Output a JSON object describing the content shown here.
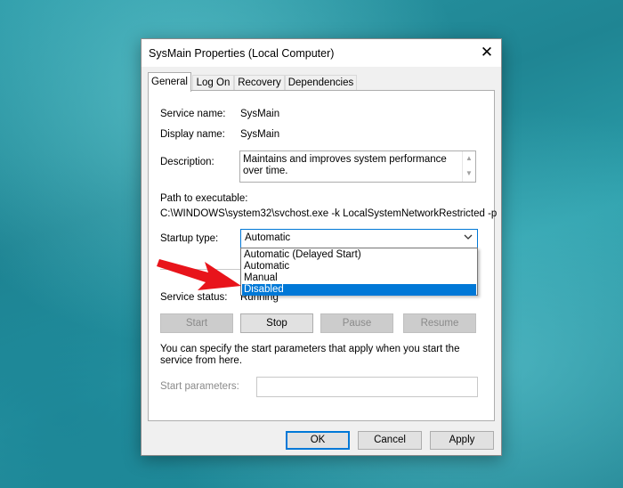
{
  "window": {
    "title": "SysMain Properties (Local Computer)",
    "close_symbol": "✕"
  },
  "tabs": [
    {
      "label": "General",
      "active": true
    },
    {
      "label": "Log On",
      "active": false
    },
    {
      "label": "Recovery",
      "active": false
    },
    {
      "label": "Dependencies",
      "active": false
    }
  ],
  "general": {
    "service_name_label": "Service name:",
    "service_name": "SysMain",
    "display_name_label": "Display name:",
    "display_name": "SysMain",
    "description_label": "Description:",
    "description": "Maintains and improves system performance over time.",
    "path_label": "Path to executable:",
    "path": "C:\\WINDOWS\\system32\\svchost.exe -k LocalSystemNetworkRestricted -p",
    "startup_type_label": "Startup type:",
    "startup_type_value": "Automatic",
    "startup_options": [
      "Automatic (Delayed Start)",
      "Automatic",
      "Manual",
      "Disabled"
    ],
    "highlighted_option": "Disabled",
    "service_status_label": "Service status:",
    "service_status": "Running",
    "buttons": {
      "start": "Start",
      "stop": "Stop",
      "pause": "Pause",
      "resume": "Resume"
    },
    "help_text": "You can specify the start parameters that apply when you start the service from here.",
    "start_params_label": "Start parameters:",
    "start_params_value": ""
  },
  "footer": {
    "ok": "OK",
    "cancel": "Cancel",
    "apply": "Apply"
  },
  "colors": {
    "accent": "#0078d7",
    "arrow": "#e8141b"
  }
}
